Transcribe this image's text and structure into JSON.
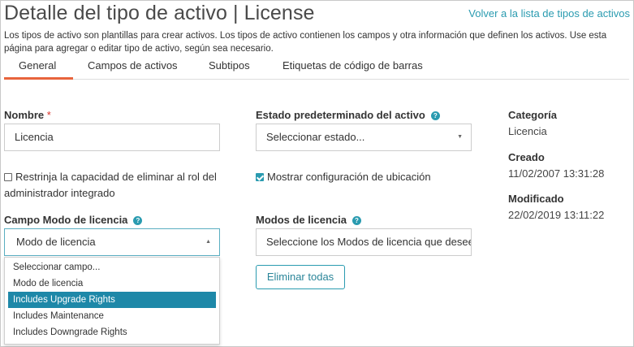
{
  "header": {
    "title": "Detalle del tipo de activo | License",
    "back_link": "Volver a la lista de tipos de activos",
    "description": "Los tipos de activo son plantillas para crear activos. Los tipos de activo contienen los campos y otra información que definen los activos. Use esta página para agregar o editar tipo de activo, según sea necesario."
  },
  "tabs": [
    {
      "label": "General",
      "active": true
    },
    {
      "label": "Campos de activos",
      "active": false
    },
    {
      "label": "Subtipos",
      "active": false
    },
    {
      "label": "Etiquetas de código de barras",
      "active": false
    }
  ],
  "form": {
    "nombre_label": "Nombre",
    "nombre_required": "*",
    "nombre_value": "Licencia",
    "estado_label": "Estado predeterminado del activo",
    "estado_value": "Seleccionar estado...",
    "restrict_label": "Restrinja la capacidad de eliminar al rol del administrador integrado",
    "restrict_checked": false,
    "location_label": "Mostrar configuración de ubicación",
    "location_checked": true,
    "campo_modo_label": "Campo Modo de licencia",
    "campo_modo_value": "Modo de licencia",
    "modos_label": "Modos de licencia",
    "modos_placeholder": "Seleccione los Modos de licencia que desee",
    "remove_all_button": "Eliminar todas"
  },
  "dropdown": {
    "options": [
      "Seleccionar campo...",
      "Modo de licencia",
      "Includes Upgrade Rights",
      "Includes Maintenance",
      "Includes Downgrade Rights"
    ],
    "highlighted": "Includes Upgrade Rights"
  },
  "sidebar": {
    "categoria_label": "Categoría",
    "categoria_value": "Licencia",
    "creado_label": "Creado",
    "creado_value": "11/02/2007 13:31:28",
    "modificado_label": "Modificado",
    "modificado_value": "22/02/2019 13:11:22"
  },
  "colors": {
    "accent": "#2a9bb0",
    "tab_underline": "#e8643c",
    "highlight": "#1e88a8",
    "required": "#d9342b"
  },
  "icons": {
    "help": "question-circle-icon",
    "select_arrow": "caret-down-icon",
    "select_arrow_open": "caret-up-icon"
  }
}
